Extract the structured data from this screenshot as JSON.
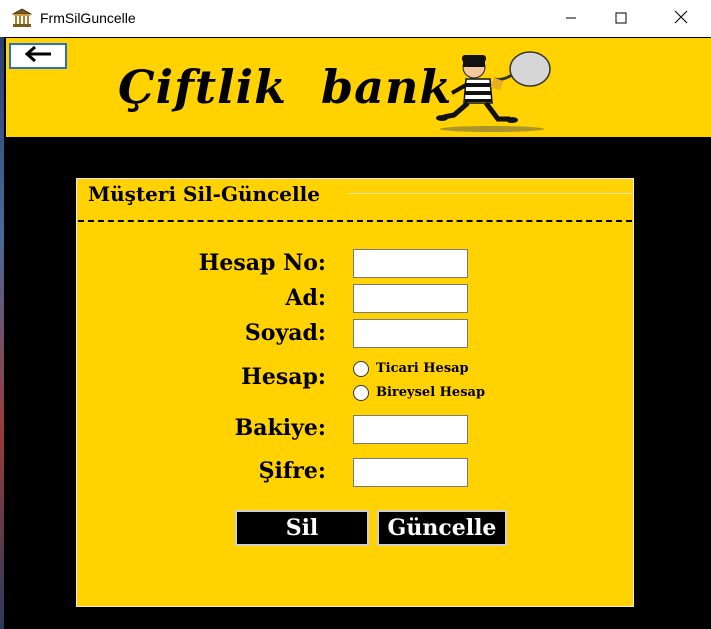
{
  "window": {
    "title": "FrmSilGuncelle",
    "icon": "bank-building-icon",
    "controls": [
      "minimize-icon",
      "maximize-icon",
      "close-icon"
    ]
  },
  "banner": {
    "brand_text": "Çiftlik  bank",
    "back_icon": "arrow-left-icon",
    "image": "thief-with-money-bag"
  },
  "form": {
    "group_title": "Müşteri Sil-Güncelle",
    "fields": {
      "hesap_no_label": "Hesap No:",
      "hesap_no_value": "",
      "ad_label": "Ad:",
      "ad_value": "",
      "soyad_label": "Soyad:",
      "soyad_value": "",
      "hesap_label": "Hesap:",
      "bakiye_label": "Bakiye:",
      "bakiye_value": "",
      "sifre_label": "Şifre:",
      "sifre_value": ""
    },
    "account_type_options": {
      "ticari": "Ticari Hesap",
      "bireysel": "Bireysel Hesap",
      "selected": null
    },
    "buttons": {
      "sil": "Sil",
      "guncelle": "Güncelle"
    }
  },
  "colors": {
    "accent": "#ffd200",
    "background": "#000000",
    "button_bg": "#000000",
    "button_text": "#ffffff"
  }
}
